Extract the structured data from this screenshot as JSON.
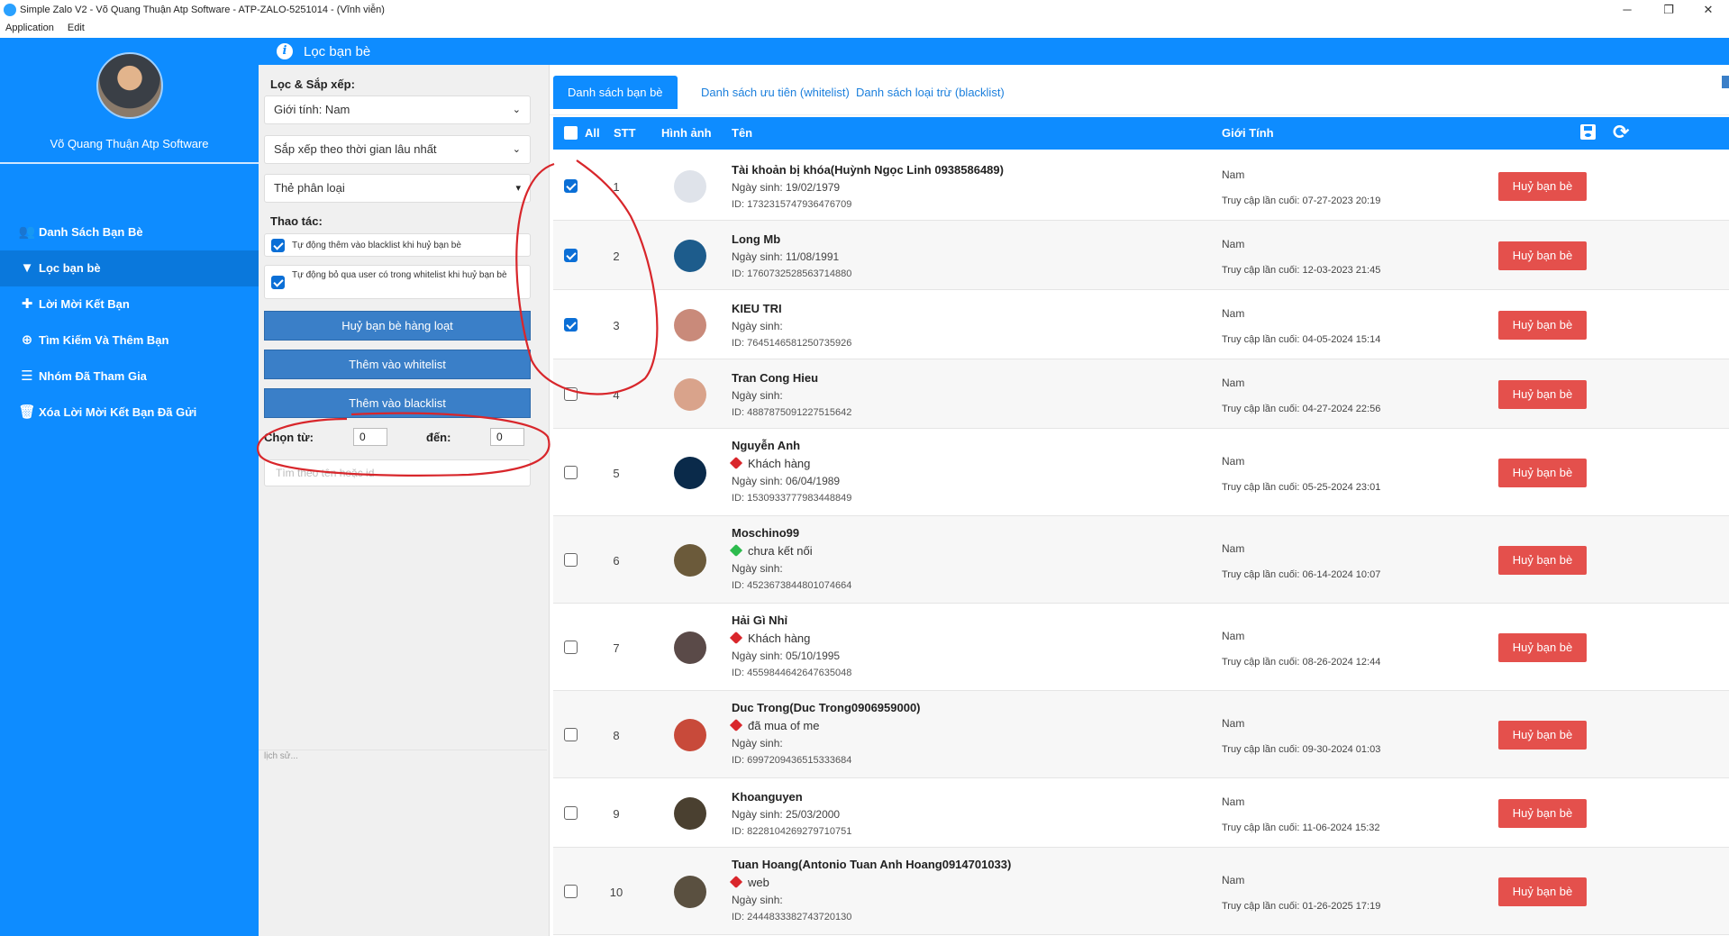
{
  "window": {
    "title": "Simple Zalo V2 - Võ Quang Thuận Atp Software - ATP-ZALO-5251014 - (Vĩnh viễn)",
    "menu": [
      "Application",
      "Edit"
    ]
  },
  "sidebar": {
    "user_name": "Võ Quang Thuận Atp Software",
    "items": [
      {
        "label": "Danh Sách Bạn Bè",
        "icon": "users-icon"
      },
      {
        "label": "Lọc bạn bè",
        "icon": "filter-icon"
      },
      {
        "label": "Lời Mời Kết Bạn",
        "icon": "plus-icon"
      },
      {
        "label": "Tìm Kiếm Và Thêm Bạn",
        "icon": "search-plus-icon"
      },
      {
        "label": "Nhóm Đã Tham Gia",
        "icon": "layers-icon"
      },
      {
        "label": "Xóa Lời Mời Kết Bạn Đã Gửi",
        "icon": "trash-icon"
      }
    ]
  },
  "header": {
    "title": "Lọc bạn bè"
  },
  "filter": {
    "section_label": "Lọc & Sắp xếp:",
    "gender_select": "Giới tính: Nam",
    "sort_select": "Sắp xếp theo thời gian lâu nhất",
    "tag_select": "Thẻ phân loại",
    "actions_label": "Thao tác:",
    "opt1": "Tự động thêm vào blacklist khi huỷ bạn bè",
    "opt2": "Tự động bỏ qua user có trong whitelist khi huỷ bạn bè",
    "btn_bulk_unfriend": "Huỷ bạn bè hàng loạt",
    "btn_whitelist": "Thêm vào whitelist",
    "btn_blacklist": "Thêm vào blacklist",
    "from_label": "Chọn từ:",
    "from_value": "0",
    "to_label": "đến:",
    "to_value": "0",
    "search_placeholder": "Tìm theo tên hoặc id",
    "history_placeholder": "lịch sử..."
  },
  "tabs": [
    "Danh sách bạn bè",
    "Danh sách ưu tiên (whitelist)",
    "Danh sách loại trừ (blacklist)"
  ],
  "table": {
    "headers": {
      "all": "All",
      "stt": "STT",
      "image": "Hình ảnh",
      "name": "Tên",
      "gender": "Giới Tính"
    },
    "unfriend_label": "Huỷ bạn bè",
    "rows": [
      {
        "stt": "1",
        "checked": true,
        "name": "Tài khoản bị khóa(Huỳnh Ngọc Linh 0938586489)",
        "tag": "",
        "tag_color": "",
        "dob": "Ngày sinh: 19/02/1979",
        "id": "ID: 1732315747936476709",
        "gender": "Nam",
        "access": "Truy cập lần cuối: 07-27-2023 20:19",
        "avatar": "#dfe3ea"
      },
      {
        "stt": "2",
        "checked": true,
        "name": "Long Mb",
        "tag": "",
        "tag_color": "",
        "dob": "Ngày sinh: 11/08/1991",
        "id": "ID: 1760732528563714880",
        "gender": "Nam",
        "access": "Truy cập lần cuối: 12-03-2023 21:45",
        "avatar": "#1d5c8c"
      },
      {
        "stt": "3",
        "checked": true,
        "name": "KIEU TRI",
        "tag": "",
        "tag_color": "",
        "dob": "Ngày sinh:",
        "id": "ID: 7645146581250735926",
        "gender": "Nam",
        "access": "Truy cập lần cuối: 04-05-2024 15:14",
        "avatar": "#c98a7a"
      },
      {
        "stt": "4",
        "checked": false,
        "name": "Tran Cong Hieu",
        "tag": "",
        "tag_color": "",
        "dob": "Ngày sinh:",
        "id": "ID: 4887875091227515642",
        "gender": "Nam",
        "access": "Truy cập lần cuối: 04-27-2024 22:56",
        "avatar": "#d9a38b"
      },
      {
        "stt": "5",
        "checked": false,
        "name": "Nguyễn Anh",
        "tag": "Khách hàng",
        "tag_color": "#d9262b",
        "dob": "Ngày sinh: 06/04/1989",
        "id": "ID: 1530933777983448849",
        "gender": "Nam",
        "access": "Truy cập lần cuối: 05-25-2024 23:01",
        "avatar": "#0a2a4a"
      },
      {
        "stt": "6",
        "checked": false,
        "name": "Moschino99",
        "tag": "chưa kết nối",
        "tag_color": "#2dbb4d",
        "dob": "Ngày sinh:",
        "id": "ID: 4523673844801074664",
        "gender": "Nam",
        "access": "Truy cập lần cuối: 06-14-2024 10:07",
        "avatar": "#6b5a3a"
      },
      {
        "stt": "7",
        "checked": false,
        "name": "Hải Gì Nhỉ",
        "tag": "Khách hàng",
        "tag_color": "#d9262b",
        "dob": "Ngày sinh: 05/10/1995",
        "id": "ID: 4559844642647635048",
        "gender": "Nam",
        "access": "Truy cập lần cuối: 08-26-2024 12:44",
        "avatar": "#5a4a48"
      },
      {
        "stt": "8",
        "checked": false,
        "name": "Duc Trong(Duc Trong0906959000)",
        "tag": "đã mua of me",
        "tag_color": "#d9262b",
        "dob": "Ngày sinh:",
        "id": "ID: 6997209436515333684",
        "gender": "Nam",
        "access": "Truy cập lần cuối: 09-30-2024 01:03",
        "avatar": "#c84a3a"
      },
      {
        "stt": "9",
        "checked": false,
        "name": "Khoanguyen",
        "tag": "",
        "tag_color": "",
        "dob": "Ngày sinh: 25/03/2000",
        "id": "ID: 8228104269279710751",
        "gender": "Nam",
        "access": "Truy cập lần cuối: 11-06-2024 15:32",
        "avatar": "#4a4030"
      },
      {
        "stt": "10",
        "checked": false,
        "name": "Tuan Hoang(Antonio Tuan Anh Hoang0914701033)",
        "tag": "web",
        "tag_color": "#d9262b",
        "dob": "Ngày sinh:",
        "id": "ID: 2444833382743720130",
        "gender": "Nam",
        "access": "Truy cập lần cuối: 01-26-2025 17:19",
        "avatar": "#5a5040"
      }
    ]
  },
  "colors": {
    "primary": "#0e8cff",
    "danger": "#e4504c",
    "button": "#3a7fc8",
    "annotation": "#d8262b"
  }
}
